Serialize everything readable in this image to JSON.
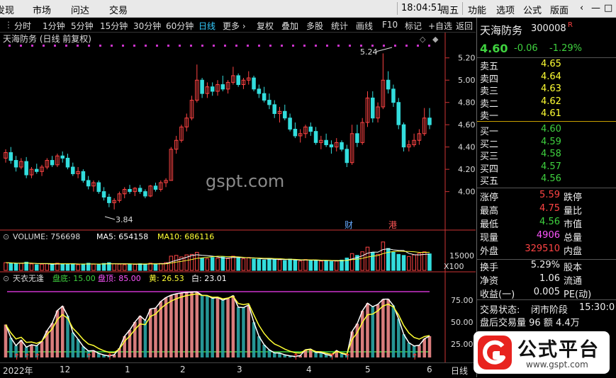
{
  "topbar": {
    "menus": [
      "发现",
      "市场",
      "问达",
      "交易"
    ],
    "time": "18:04:51",
    "weekday": "周五",
    "right_menus": [
      "功能",
      "选项",
      "公式",
      "版面"
    ],
    "win_controls": [
      "‹",
      "—",
      "□",
      "✕"
    ]
  },
  "toolbar": {
    "periods": [
      "分时",
      "1分钟",
      "5分钟",
      "15分钟",
      "30分钟",
      "60分钟",
      "日线",
      "更多 ›"
    ],
    "active_period": "日线",
    "tools": [
      "复权",
      "叠加",
      "多股",
      "统计",
      "画线",
      "F10",
      "标记",
      "+自选",
      "返回"
    ]
  },
  "chart_header": {
    "title": "天海防务 (日线 前复权)",
    "wm_label": "gspt.com"
  },
  "price_axis": {
    "labels": [
      "5.20",
      "5.00",
      "4.80",
      "4.60",
      "4.40",
      "4.20",
      "4.00"
    ]
  },
  "annotations": {
    "high": "5.24",
    "low": "3.84",
    "cai": "财",
    "gang": "港"
  },
  "volume_panel": {
    "volume_label": "VOLUME: 756698",
    "ma5_label": "MA5: 654158",
    "ma10_label": "MA10: 686116",
    "axis_value": "15000",
    "axis_unit": "X100"
  },
  "indicator_panel": {
    "name": "天衣无逢",
    "pandi": "盘底: 15.00",
    "panding": "盘顶: 85.00",
    "huang": "黄: 26.53",
    "bai": "白: 23.01",
    "axis": [
      "75.00",
      "50.00",
      "25.00"
    ]
  },
  "date_axis": {
    "labels": [
      "2022年",
      "12",
      "1",
      "2",
      "3",
      "4",
      "5",
      "6"
    ],
    "period": "日线"
  },
  "quote": {
    "name": "天海防务",
    "code": "300008",
    "badge": "R",
    "price": "4.60",
    "change": "-0.06",
    "change_pct": "-1.29%",
    "asks": [
      {
        "label": "卖五",
        "price": "4.65"
      },
      {
        "label": "卖四",
        "price": "4.64"
      },
      {
        "label": "卖三",
        "price": "4.63"
      },
      {
        "label": "卖二",
        "price": "4.62"
      },
      {
        "label": "卖一",
        "price": "4.61"
      }
    ],
    "bids": [
      {
        "label": "买一",
        "price": "4.60"
      },
      {
        "label": "买二",
        "price": "4.59"
      },
      {
        "label": "买三",
        "price": "4.58"
      },
      {
        "label": "买四",
        "price": "4.57"
      },
      {
        "label": "买五",
        "price": "4.56"
      }
    ],
    "stats": [
      {
        "l": "涨停",
        "v": "5.59",
        "r": "跌停"
      },
      {
        "l": "最高",
        "v": "4.75",
        "r": "量比"
      },
      {
        "l": "最低",
        "v": "4.56",
        "r": "市值"
      },
      {
        "l": "现量",
        "v": "4906",
        "r": "总量"
      },
      {
        "l": "外盘",
        "v": "329510",
        "r": "内盘"
      }
    ],
    "extra": [
      {
        "l": "换手",
        "v": "5.29%",
        "r": "股本"
      },
      {
        "l": "净资",
        "v": "1.06",
        "r": "流通"
      },
      {
        "l": "收益(一)",
        "v": "0.005",
        "r": "PE(动)"
      }
    ],
    "trade_status_label": "交易状态:",
    "trade_status": "闭市阶段",
    "trade_time": "15:30:0",
    "after_hours": "盘后交易量 96 额 4.4万"
  },
  "logo": {
    "text": "公式平台",
    "url": "www.gspt.com"
  },
  "colors": {
    "up": "#ff4444",
    "down": "#33dddd",
    "ma5": "#ffffff",
    "ma10": "#ffff33",
    "purple": "#cc33cc"
  },
  "chart_data": {
    "type": "candlestick",
    "title": "天海防务 (日线 前复权)",
    "ylim": [
      3.75,
      5.3
    ],
    "high_label": 5.24,
    "low_label": 3.84,
    "candles": [
      [
        4.3,
        4.38,
        4.26,
        4.35
      ],
      [
        4.35,
        4.4,
        4.25,
        4.28
      ],
      [
        4.28,
        4.32,
        4.18,
        4.22
      ],
      [
        4.22,
        4.3,
        4.2,
        4.27
      ],
      [
        4.27,
        4.31,
        4.12,
        4.15
      ],
      [
        4.15,
        4.22,
        4.12,
        4.2
      ],
      [
        4.2,
        4.25,
        4.16,
        4.18
      ],
      [
        4.18,
        4.24,
        4.14,
        4.22
      ],
      [
        4.22,
        4.3,
        4.2,
        4.28
      ],
      [
        4.28,
        4.32,
        4.22,
        4.24
      ],
      [
        4.24,
        4.34,
        4.22,
        4.32
      ],
      [
        4.32,
        4.36,
        4.26,
        4.3
      ],
      [
        4.3,
        4.34,
        4.2,
        4.22
      ],
      [
        4.22,
        4.26,
        4.14,
        4.16
      ],
      [
        4.16,
        4.22,
        4.12,
        4.18
      ],
      [
        4.18,
        4.2,
        4.08,
        4.1
      ],
      [
        4.1,
        4.14,
        4.02,
        4.05
      ],
      [
        4.05,
        4.1,
        4.0,
        4.08
      ],
      [
        4.08,
        4.1,
        3.98,
        4.0
      ],
      [
        4.0,
        4.04,
        3.92,
        3.95
      ],
      [
        3.95,
        3.98,
        3.86,
        3.9
      ],
      [
        3.9,
        3.94,
        3.84,
        3.92
      ],
      [
        3.92,
        4.0,
        3.9,
        3.98
      ],
      [
        3.98,
        4.04,
        3.94,
        4.02
      ],
      [
        4.02,
        4.06,
        3.98,
        4.0
      ],
      [
        4.0,
        4.04,
        3.96,
        4.03
      ],
      [
        4.03,
        4.06,
        3.98,
        4.0
      ],
      [
        4.0,
        4.02,
        3.94,
        3.96
      ],
      [
        3.96,
        4.06,
        3.95,
        4.05
      ],
      [
        4.05,
        4.08,
        4.0,
        4.02
      ],
      [
        4.02,
        4.1,
        4.0,
        4.08
      ],
      [
        4.08,
        4.12,
        4.04,
        4.1
      ],
      [
        4.1,
        4.4,
        4.1,
        4.38
      ],
      [
        4.38,
        4.5,
        4.34,
        4.46
      ],
      [
        4.46,
        4.6,
        4.44,
        4.58
      ],
      [
        4.58,
        4.7,
        4.54,
        4.66
      ],
      [
        4.66,
        4.86,
        4.64,
        4.82
      ],
      [
        4.82,
        5.14,
        4.8,
        5.0
      ],
      [
        5.0,
        5.02,
        4.84,
        4.88
      ],
      [
        4.88,
        4.98,
        4.84,
        4.94
      ],
      [
        4.94,
        4.98,
        4.86,
        4.9
      ],
      [
        4.9,
        5.0,
        4.86,
        4.96
      ],
      [
        4.96,
        5.04,
        4.9,
        4.92
      ],
      [
        4.92,
        5.0,
        4.88,
        4.98
      ],
      [
        4.98,
        5.12,
        4.96,
        5.04
      ],
      [
        5.04,
        5.06,
        4.94,
        4.96
      ],
      [
        4.96,
        5.02,
        4.92,
        5.0
      ],
      [
        5.0,
        5.08,
        4.96,
        5.02
      ],
      [
        5.02,
        5.04,
        4.9,
        4.92
      ],
      [
        4.92,
        4.96,
        4.84,
        4.88
      ],
      [
        4.88,
        4.94,
        4.8,
        4.82
      ],
      [
        4.82,
        4.88,
        4.74,
        4.78
      ],
      [
        4.78,
        4.82,
        4.66,
        4.7
      ],
      [
        4.7,
        4.76,
        4.62,
        4.72
      ],
      [
        4.72,
        4.78,
        4.64,
        4.66
      ],
      [
        4.66,
        4.7,
        4.54,
        4.56
      ],
      [
        4.56,
        4.62,
        4.48,
        4.5
      ],
      [
        4.5,
        4.56,
        4.44,
        4.52
      ],
      [
        4.52,
        4.6,
        4.48,
        4.58
      ],
      [
        4.58,
        4.62,
        4.5,
        4.54
      ],
      [
        4.54,
        4.58,
        4.42,
        4.44
      ],
      [
        4.44,
        4.5,
        4.38,
        4.46
      ],
      [
        4.46,
        4.52,
        4.4,
        4.42
      ],
      [
        4.42,
        4.46,
        4.34,
        4.4
      ],
      [
        4.4,
        4.48,
        4.36,
        4.44
      ],
      [
        4.44,
        4.46,
        4.36,
        4.38
      ],
      [
        4.38,
        4.42,
        4.22,
        4.26
      ],
      [
        4.26,
        4.6,
        4.24,
        4.52
      ],
      [
        4.52,
        4.6,
        4.4,
        4.44
      ],
      [
        4.44,
        4.66,
        4.42,
        4.62
      ],
      [
        4.62,
        4.9,
        4.58,
        4.84
      ],
      [
        4.84,
        4.9,
        4.62,
        4.66
      ],
      [
        4.66,
        4.8,
        4.62,
        4.76
      ],
      [
        4.76,
        5.24,
        4.74,
        5.0
      ],
      [
        5.0,
        5.08,
        4.88,
        4.92
      ],
      [
        4.92,
        4.96,
        4.76,
        4.8
      ],
      [
        4.8,
        4.84,
        4.56,
        4.6
      ],
      [
        4.6,
        4.62,
        4.36,
        4.4
      ],
      [
        4.4,
        4.46,
        4.36,
        4.42
      ],
      [
        4.42,
        4.52,
        4.4,
        4.46
      ],
      [
        4.46,
        4.56,
        4.42,
        4.52
      ],
      [
        4.52,
        4.75,
        4.5,
        4.66
      ],
      [
        4.66,
        4.75,
        4.56,
        4.6
      ]
    ],
    "volume": [
      30,
      28,
      26,
      27,
      32,
      25,
      22,
      24,
      26,
      23,
      28,
      25,
      24,
      26,
      22,
      25,
      28,
      24,
      22,
      27,
      30,
      26,
      24,
      22,
      25,
      23,
      26,
      24,
      28,
      25,
      27,
      30,
      55,
      58,
      52,
      60,
      62,
      70,
      48,
      45,
      50,
      47,
      52,
      46,
      55,
      49,
      45,
      50,
      44,
      42,
      40,
      46,
      43,
      41,
      38,
      44,
      40,
      36,
      42,
      38,
      40,
      36,
      38,
      34,
      36,
      40,
      48,
      65,
      58,
      72,
      90,
      70,
      62,
      110,
      85,
      70,
      62,
      58,
      54,
      60,
      66,
      72,
      64
    ]
  }
}
